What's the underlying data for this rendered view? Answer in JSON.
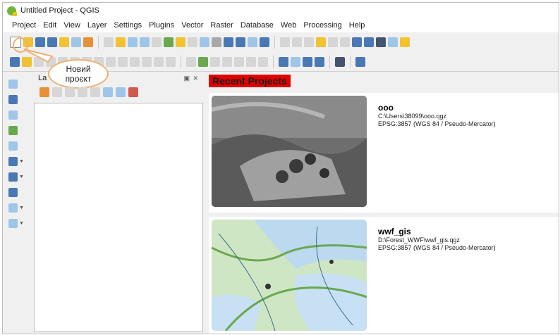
{
  "window": {
    "title": "Untitled Project - QGIS"
  },
  "menu": [
    "Project",
    "Edit",
    "View",
    "Layer",
    "Settings",
    "Plugins",
    "Vector",
    "Raster",
    "Database",
    "Web",
    "Processing",
    "Help"
  ],
  "callout": {
    "line1": "Новий",
    "line2": "проєкт"
  },
  "layers_panel": {
    "title": "La"
  },
  "recent": {
    "title": "Recent Projects",
    "projects": [
      {
        "name": "ooo",
        "path": "C:\\Users\\38099\\ooo.qgz",
        "crs": "EPSG:3857 (WGS 84 / Pseudo-Mercator)"
      },
      {
        "name": "wwf_gis",
        "path": "D:\\Forest_WWF\\wwf_gis.qgz",
        "crs": "EPSG:3857 (WGS 84 / Pseudo-Mercator)"
      }
    ]
  },
  "icons": {
    "toolbar1": [
      "new-project-icon",
      "open-folder-icon",
      "save-icon",
      "save-as-icon",
      "new-print-layout-icon",
      "layout-manager-icon",
      "style-manager-icon",
      "pan-icon",
      "pan-to-selection-icon",
      "zoom-in-icon",
      "zoom-out-icon",
      "zoom-full-icon",
      "zoom-layer-icon",
      "zoom-last-icon",
      "refresh-icon",
      "identify-icon",
      "measure-icon",
      "statistics-icon",
      "sum-icon",
      "attribute-table-icon",
      "tips-icon"
    ],
    "left": [
      "add-vector-icon",
      "add-raster-icon",
      "add-delimited-icon",
      "add-gps-icon",
      "add-spatialite-icon",
      "add-postgis-icon",
      "add-wms-icon",
      "add-wfs-icon",
      "add-wcs-icon",
      "add-virtual-icon"
    ]
  }
}
